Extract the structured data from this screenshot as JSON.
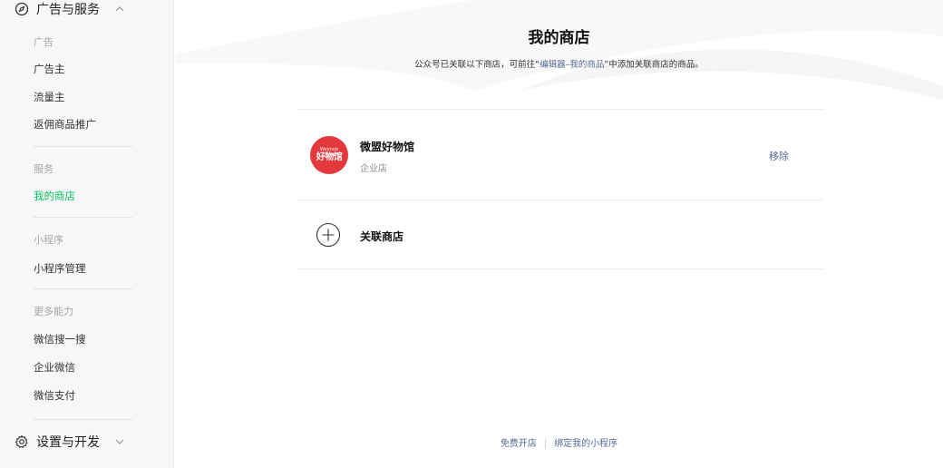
{
  "sidebar": {
    "section_ads": {
      "label": "广告与服务",
      "icon": "compass-icon",
      "chevron": "chevron-up-icon"
    },
    "group_ads_title": "广告",
    "ads_items": [
      "广告主",
      "流量主",
      "返佣商品推广"
    ],
    "group_services_title": "服务",
    "services_items": [
      "我的商店"
    ],
    "group_miniprogram_title": "小程序",
    "miniprogram_items": [
      "小程序管理"
    ],
    "group_more_title": "更多能力",
    "more_items": [
      "微信搜一搜",
      "企业微信",
      "微信支付"
    ],
    "section_settings": {
      "label": "设置与开发",
      "icon": "gear-icon",
      "chevron": "chevron-down-icon"
    },
    "active_color": "#07c160"
  },
  "main": {
    "title": "我的商店",
    "subtitle_before": "公众号已关联以下商店，可前往“",
    "subtitle_link": "编辑器–我的商品",
    "subtitle_after": "”中添加关联商店的商品。",
    "shop": {
      "name": "微盟好物馆",
      "type": "企业店",
      "logo_small": "Weimob",
      "logo_big": "好物馆",
      "logo_color": "#e4393c",
      "remove_label": "移除"
    },
    "add_shop_label": "关联商店",
    "footer": {
      "free_open": "免费开店",
      "separator": "|",
      "bind_miniprogram": "绑定我的小程序"
    },
    "link_color": "#576b95"
  }
}
